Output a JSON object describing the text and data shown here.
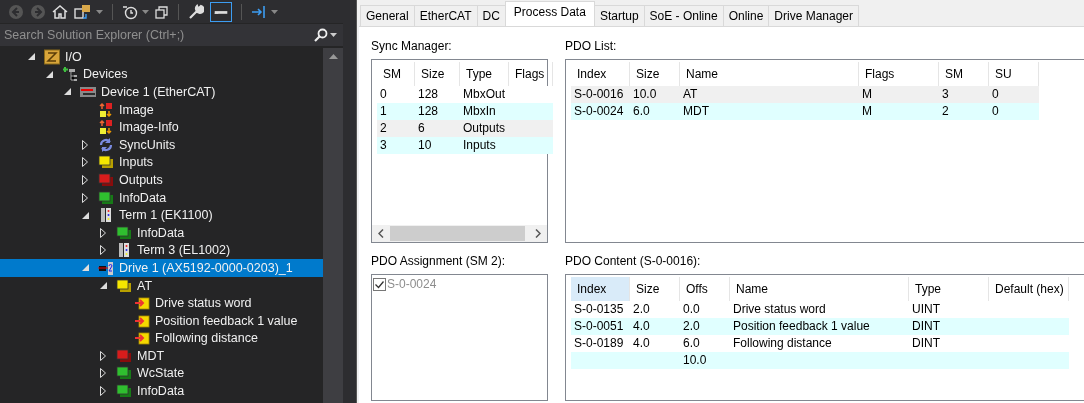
{
  "toolbar": {
    "search": {
      "placeholder": "Search Solution Explorer (Ctrl+;)"
    }
  },
  "tree": [
    {
      "label": "I/O",
      "kind": "io",
      "expanded": true,
      "selected": false,
      "children": [
        {
          "label": "Devices",
          "kind": "devices",
          "expanded": true,
          "selected": false,
          "children": [
            {
              "label": "Device 1 (EtherCAT)",
              "kind": "ethercat",
              "expanded": true,
              "selected": false,
              "children": [
                {
                  "label": "Image",
                  "kind": "image",
                  "selected": false
                },
                {
                  "label": "Image-Info",
                  "kind": "image",
                  "selected": false
                },
                {
                  "label": "SyncUnits",
                  "kind": "sync",
                  "expanded": false,
                  "selected": false
                },
                {
                  "label": "Inputs",
                  "kind": "inputs",
                  "expanded": false,
                  "selected": false
                },
                {
                  "label": "Outputs",
                  "kind": "outputs",
                  "expanded": false,
                  "selected": false
                },
                {
                  "label": "InfoData",
                  "kind": "infodata",
                  "expanded": false,
                  "selected": false
                },
                {
                  "label": "Term 1 (EK1100)",
                  "kind": "term",
                  "expanded": true,
                  "selected": false,
                  "children": [
                    {
                      "label": "InfoData",
                      "kind": "infodata",
                      "expanded": false,
                      "selected": false
                    },
                    {
                      "label": "Term 3 (EL1002)",
                      "kind": "term",
                      "expanded": false,
                      "selected": false
                    }
                  ]
                },
                {
                  "label": "Drive 1 (AX5192-0000-0203)_1",
                  "kind": "drive",
                  "expanded": true,
                  "selected": true,
                  "children": [
                    {
                      "label": "AT",
                      "kind": "inputs",
                      "expanded": true,
                      "selected": false,
                      "children": [
                        {
                          "label": "Drive status word",
                          "kind": "variable",
                          "selected": false
                        },
                        {
                          "label": "Position feedback 1 value",
                          "kind": "variable",
                          "selected": false
                        },
                        {
                          "label": "Following distance",
                          "kind": "variable",
                          "selected": false
                        }
                      ]
                    },
                    {
                      "label": "MDT",
                      "kind": "outputs",
                      "expanded": false,
                      "selected": false
                    },
                    {
                      "label": "WcState",
                      "kind": "infodata",
                      "expanded": false,
                      "selected": false
                    },
                    {
                      "label": "InfoData",
                      "kind": "infodata",
                      "expanded": false,
                      "selected": false
                    }
                  ]
                }
              ]
            }
          ]
        }
      ]
    }
  ],
  "tabs": [
    {
      "label": "General",
      "selected": false
    },
    {
      "label": "EtherCAT",
      "selected": false
    },
    {
      "label": "DC",
      "selected": false
    },
    {
      "label": "Process Data",
      "selected": true
    },
    {
      "label": "Startup",
      "selected": false
    },
    {
      "label": "SoE - Online",
      "selected": false
    },
    {
      "label": "Online",
      "selected": false
    },
    {
      "label": "Drive Manager",
      "selected": false
    }
  ],
  "sync_manager": {
    "label": "Sync Manager:",
    "columns": [
      "SM",
      "Size",
      "Type",
      "Flags"
    ],
    "rows": [
      {
        "sm": "0",
        "size": "128",
        "type": "MbxOut",
        "selected": false
      },
      {
        "sm": "1",
        "size": "128",
        "type": "MbxIn",
        "selected": false
      },
      {
        "sm": "2",
        "size": "6",
        "type": "Outputs",
        "selected": true
      },
      {
        "sm": "3",
        "size": "10",
        "type": "Inputs",
        "selected": false
      }
    ]
  },
  "pdo_list": {
    "label": "PDO List:",
    "columns": [
      "Index",
      "Size",
      "Name",
      "Flags",
      "SM",
      "SU"
    ],
    "rows": [
      {
        "index": "S-0-0016",
        "size": "10.0",
        "name": "AT",
        "flags": "M",
        "sm": "3",
        "su": "0",
        "selected": true
      },
      {
        "index": "S-0-0024",
        "size": "6.0",
        "name": "MDT",
        "flags": "M",
        "sm": "2",
        "su": "0",
        "selected": false
      }
    ]
  },
  "pdo_assignment": {
    "label": "PDO Assignment (SM 2):",
    "items": [
      {
        "label": "S-0-0024",
        "checked": true,
        "disabled": true
      }
    ]
  },
  "pdo_content": {
    "label": "PDO Content (S-0-0016):",
    "columns": [
      {
        "label": "Index",
        "highlighted": true
      },
      {
        "label": "Size",
        "highlighted": false
      },
      {
        "label": "Offs",
        "highlighted": false
      },
      {
        "label": "Name",
        "highlighted": false
      },
      {
        "label": "Type",
        "highlighted": false
      },
      {
        "label": "Default (hex)",
        "highlighted": false
      }
    ],
    "rows": [
      {
        "index": "S-0-0135",
        "size": "2.0",
        "offs": "0.0",
        "name": "Drive status word",
        "type": "UINT",
        "selected": false
      },
      {
        "index": "S-0-0051",
        "size": "4.0",
        "offs": "2.0",
        "name": "Position feedback 1 value",
        "type": "DINT",
        "selected": false
      },
      {
        "index": "S-0-0189",
        "size": "4.0",
        "offs": "6.0",
        "name": "Following distance",
        "type": "DINT",
        "selected": false
      },
      {
        "offs": "10.0",
        "selected": false
      }
    ]
  }
}
